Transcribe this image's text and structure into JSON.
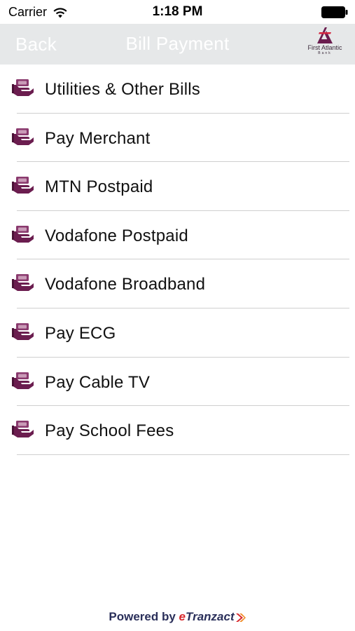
{
  "status_bar": {
    "carrier": "Carrier",
    "time": "1:18 PM"
  },
  "nav": {
    "back_label": "Back",
    "title": "Bill Payment",
    "logo_name": "First Atlantic",
    "logo_sub": "Bank"
  },
  "bill_items": [
    {
      "label": "Utilities & Other Bills"
    },
    {
      "label": "Pay Merchant"
    },
    {
      "label": "MTN Postpaid"
    },
    {
      "label": "Vodafone Postpaid"
    },
    {
      "label": "Vodafone Broadband"
    },
    {
      "label": "Pay ECG"
    },
    {
      "label": "Pay Cable TV"
    },
    {
      "label": "Pay School Fees"
    }
  ],
  "footer": {
    "powered_by": "Powered by",
    "brand_e": "e",
    "brand_rest": "Tranzact"
  },
  "colors": {
    "nav_background": "#e6e8e9",
    "icon_purple": "#6b1d4f",
    "divider": "#cfcfcf",
    "footer_text": "#2a2f5a",
    "brand_red": "#d8282c"
  },
  "icons": {
    "row_icon": "hand-money-icon",
    "wifi": "wifi-icon",
    "battery": "battery-icon"
  }
}
